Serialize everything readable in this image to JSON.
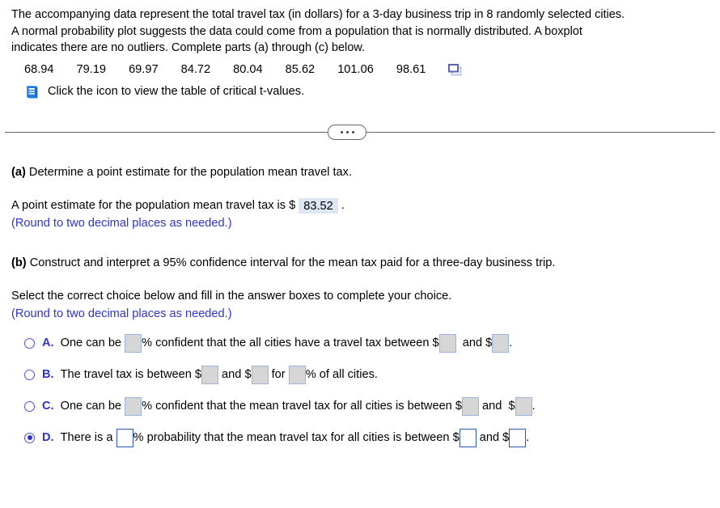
{
  "intro": {
    "lines": [
      "The accompanying data represent the total travel tax (in dollars) for a 3-day business trip in 8 randomly selected cities.",
      "A normal probability plot suggests the data could come from a population that is normally distributed. A boxplot",
      "indicates there are no outliers. Complete parts (a) through (c) below."
    ],
    "data_values": [
      "68.94",
      "79.19",
      "69.97",
      "84.72",
      "80.04",
      "85.62",
      "101.06",
      "98.61"
    ],
    "copy_icon": "copy-icon",
    "table_link": {
      "icon": "book-icon",
      "text": "Click the icon to view the table of critical t-values."
    }
  },
  "divider": {
    "ellipsis": "…"
  },
  "part_a": {
    "heading_label": "(a)",
    "heading_text": " Determine a point estimate for the population mean travel tax.",
    "sentence_before": "A point estimate for the population mean travel tax is $",
    "answer_value": "83.52",
    "sentence_after": ".",
    "rounding_note": "(Round to two decimal places as needed.)"
  },
  "part_b": {
    "heading_label": "(b)",
    "heading_text": " Construct and interpret a 95% confidence interval for the mean tax paid for a three-day business trip.",
    "instruction": "Select the correct choice below and fill in the answer boxes to complete your choice.",
    "rounding_note": "(Round to two decimal places as needed.)",
    "selected": "D",
    "choices": [
      {
        "letter": "A.",
        "selected": false,
        "segments": [
          "One can be ",
          "% confident that the all cities have a travel tax between $",
          "  and $",
          "."
        ],
        "box_count": 3
      },
      {
        "letter": "B.",
        "selected": false,
        "segments": [
          "The travel tax is between $",
          " and $",
          " for ",
          "% of all cities."
        ],
        "box_count": 3
      },
      {
        "letter": "C.",
        "selected": false,
        "segments": [
          "One can be ",
          "% confident that the mean travel tax for all cities is between $",
          " and  $",
          "."
        ],
        "box_count": 3
      },
      {
        "letter": "D.",
        "selected": true,
        "segments": [
          "There is a ",
          "% probability that the mean travel tax for all cities is between $",
          " and $",
          "."
        ],
        "box_count": 3
      }
    ]
  }
}
